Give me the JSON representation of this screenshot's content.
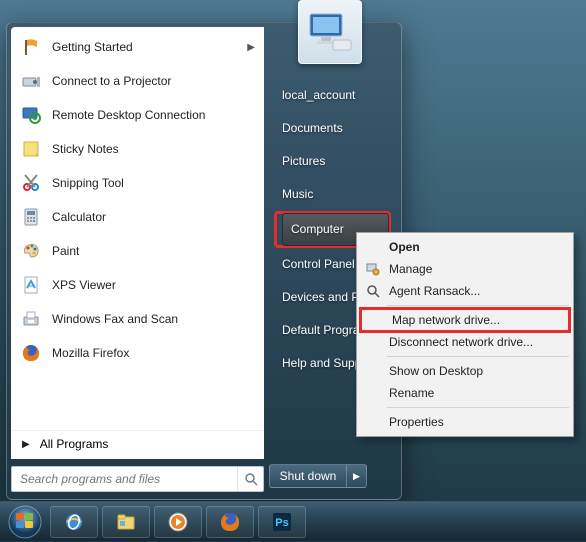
{
  "user": {
    "name": "local_account"
  },
  "left_programs": [
    {
      "name": "Getting Started",
      "icon": "flag",
      "has_submenu": true
    },
    {
      "name": "Connect to a Projector",
      "icon": "projector"
    },
    {
      "name": "Remote Desktop Connection",
      "icon": "rdp"
    },
    {
      "name": "Sticky Notes",
      "icon": "sticky"
    },
    {
      "name": "Snipping Tool",
      "icon": "scissors"
    },
    {
      "name": "Calculator",
      "icon": "calc"
    },
    {
      "name": "Paint",
      "icon": "paint"
    },
    {
      "name": "XPS Viewer",
      "icon": "xps"
    },
    {
      "name": "Windows Fax and Scan",
      "icon": "fax"
    },
    {
      "name": "Mozilla Firefox",
      "icon": "firefox"
    }
  ],
  "all_programs_label": "All Programs",
  "search": {
    "placeholder": "Search programs and files"
  },
  "right_items": [
    {
      "label": "local_account"
    },
    {
      "label": "Documents"
    },
    {
      "label": "Pictures"
    },
    {
      "label": "Music"
    },
    {
      "label": "Computer",
      "selected": true,
      "highlighted": true
    },
    {
      "label": "Control Panel"
    },
    {
      "label": "Devices and Printers",
      "truncated": "Devices and Pr"
    },
    {
      "label": "Default Programs",
      "truncated": "Default Progra"
    },
    {
      "label": "Help and Support",
      "truncated": "Help and Supp"
    }
  ],
  "shutdown": {
    "label": "Shut down"
  },
  "context_menu": [
    {
      "label": "Open",
      "bold": true
    },
    {
      "label": "Manage",
      "icon": "manage"
    },
    {
      "label": "Agent Ransack...",
      "icon": "ransack"
    },
    {
      "sep": true
    },
    {
      "label": "Map network drive...",
      "highlighted": true
    },
    {
      "label": "Disconnect network drive..."
    },
    {
      "sep": true
    },
    {
      "label": "Show on Desktop"
    },
    {
      "label": "Rename"
    },
    {
      "sep": true
    },
    {
      "label": "Properties"
    }
  ],
  "colors": {
    "highlight": "#e52b2b"
  }
}
